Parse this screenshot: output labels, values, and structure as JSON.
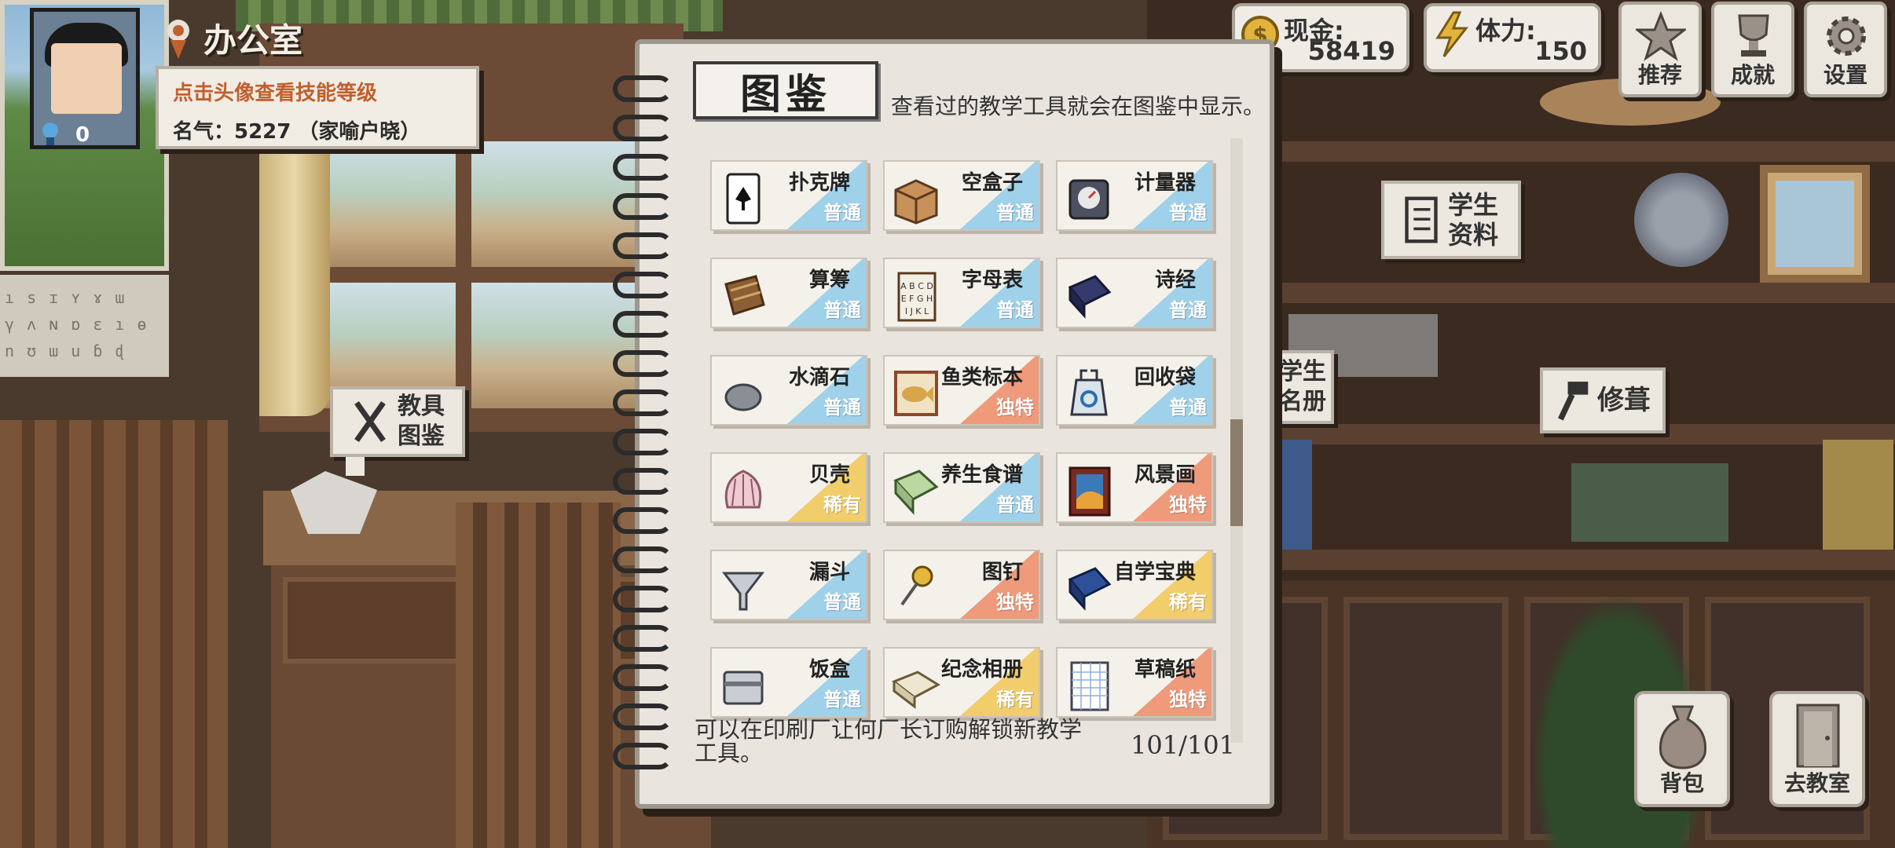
{
  "hud": {
    "location": "办公室",
    "avatar_level": "0",
    "info_hint": "点击头像查看技能等级",
    "fame": "名气：5227 （家喻户晓）",
    "money_label": "现金:",
    "money_value": "58419",
    "stamina_label": "体力:",
    "stamina_value": "150",
    "buttons": {
      "recommend": "推荐",
      "achievement": "成就",
      "settings": "设置"
    }
  },
  "scene_bubbles": {
    "toolbook": "教具\n图鉴",
    "student_info": "学生\n资料",
    "roster": "学生\n名册",
    "repair": "修葺"
  },
  "bottom": {
    "bag": "背包",
    "classroom": "去教室"
  },
  "alphabet_poster": "ı s ɪ ʏ ɤ ɯ\nγ ʌ ɴ ɒ ɛ ı ɵ\nn ʊ ɯ u ɓ ɖ",
  "notebook": {
    "title": "图鉴",
    "subtitle": "查看过的教学工具就会在图鉴中显示。",
    "footer": "可以在印刷厂让何厂长订购解锁新教学工具。",
    "count": "101/101",
    "items": [
      {
        "name": "扑克牌",
        "rarity": "普通",
        "tier": "common",
        "icon": "playing-card-icon"
      },
      {
        "name": "空盒子",
        "rarity": "普通",
        "tier": "common",
        "icon": "box-icon"
      },
      {
        "name": "计量器",
        "rarity": "普通",
        "tier": "common",
        "icon": "scale-icon"
      },
      {
        "name": "算筹",
        "rarity": "普通",
        "tier": "common",
        "icon": "counting-rods-icon"
      },
      {
        "name": "字母表",
        "rarity": "普通",
        "tier": "common",
        "icon": "alphabet-icon"
      },
      {
        "name": "诗经",
        "rarity": "普通",
        "tier": "common",
        "icon": "book-icon"
      },
      {
        "name": "水滴石",
        "rarity": "普通",
        "tier": "common",
        "icon": "stone-icon"
      },
      {
        "name": "鱼类标本",
        "rarity": "独特",
        "tier": "unique",
        "icon": "fish-icon"
      },
      {
        "name": "回收袋",
        "rarity": "普通",
        "tier": "common",
        "icon": "recycle-bag-icon"
      },
      {
        "name": "贝壳",
        "rarity": "稀有",
        "tier": "rare",
        "icon": "shell-icon"
      },
      {
        "name": "养生食谱",
        "rarity": "普通",
        "tier": "common",
        "icon": "recipe-book-icon"
      },
      {
        "name": "风景画",
        "rarity": "独特",
        "tier": "unique",
        "icon": "painting-icon"
      },
      {
        "name": "漏斗",
        "rarity": "普通",
        "tier": "common",
        "icon": "funnel-icon"
      },
      {
        "name": "图钉",
        "rarity": "独特",
        "tier": "unique",
        "icon": "pushpin-icon"
      },
      {
        "name": "自学宝典",
        "rarity": "稀有",
        "tier": "rare",
        "icon": "blue-book-icon"
      },
      {
        "name": "饭盒",
        "rarity": "普通",
        "tier": "common",
        "icon": "lunchbox-icon"
      },
      {
        "name": "纪念相册",
        "rarity": "稀有",
        "tier": "rare",
        "icon": "album-icon"
      },
      {
        "name": "草稿纸",
        "rarity": "独特",
        "tier": "unique",
        "icon": "notepad-icon"
      }
    ]
  }
}
